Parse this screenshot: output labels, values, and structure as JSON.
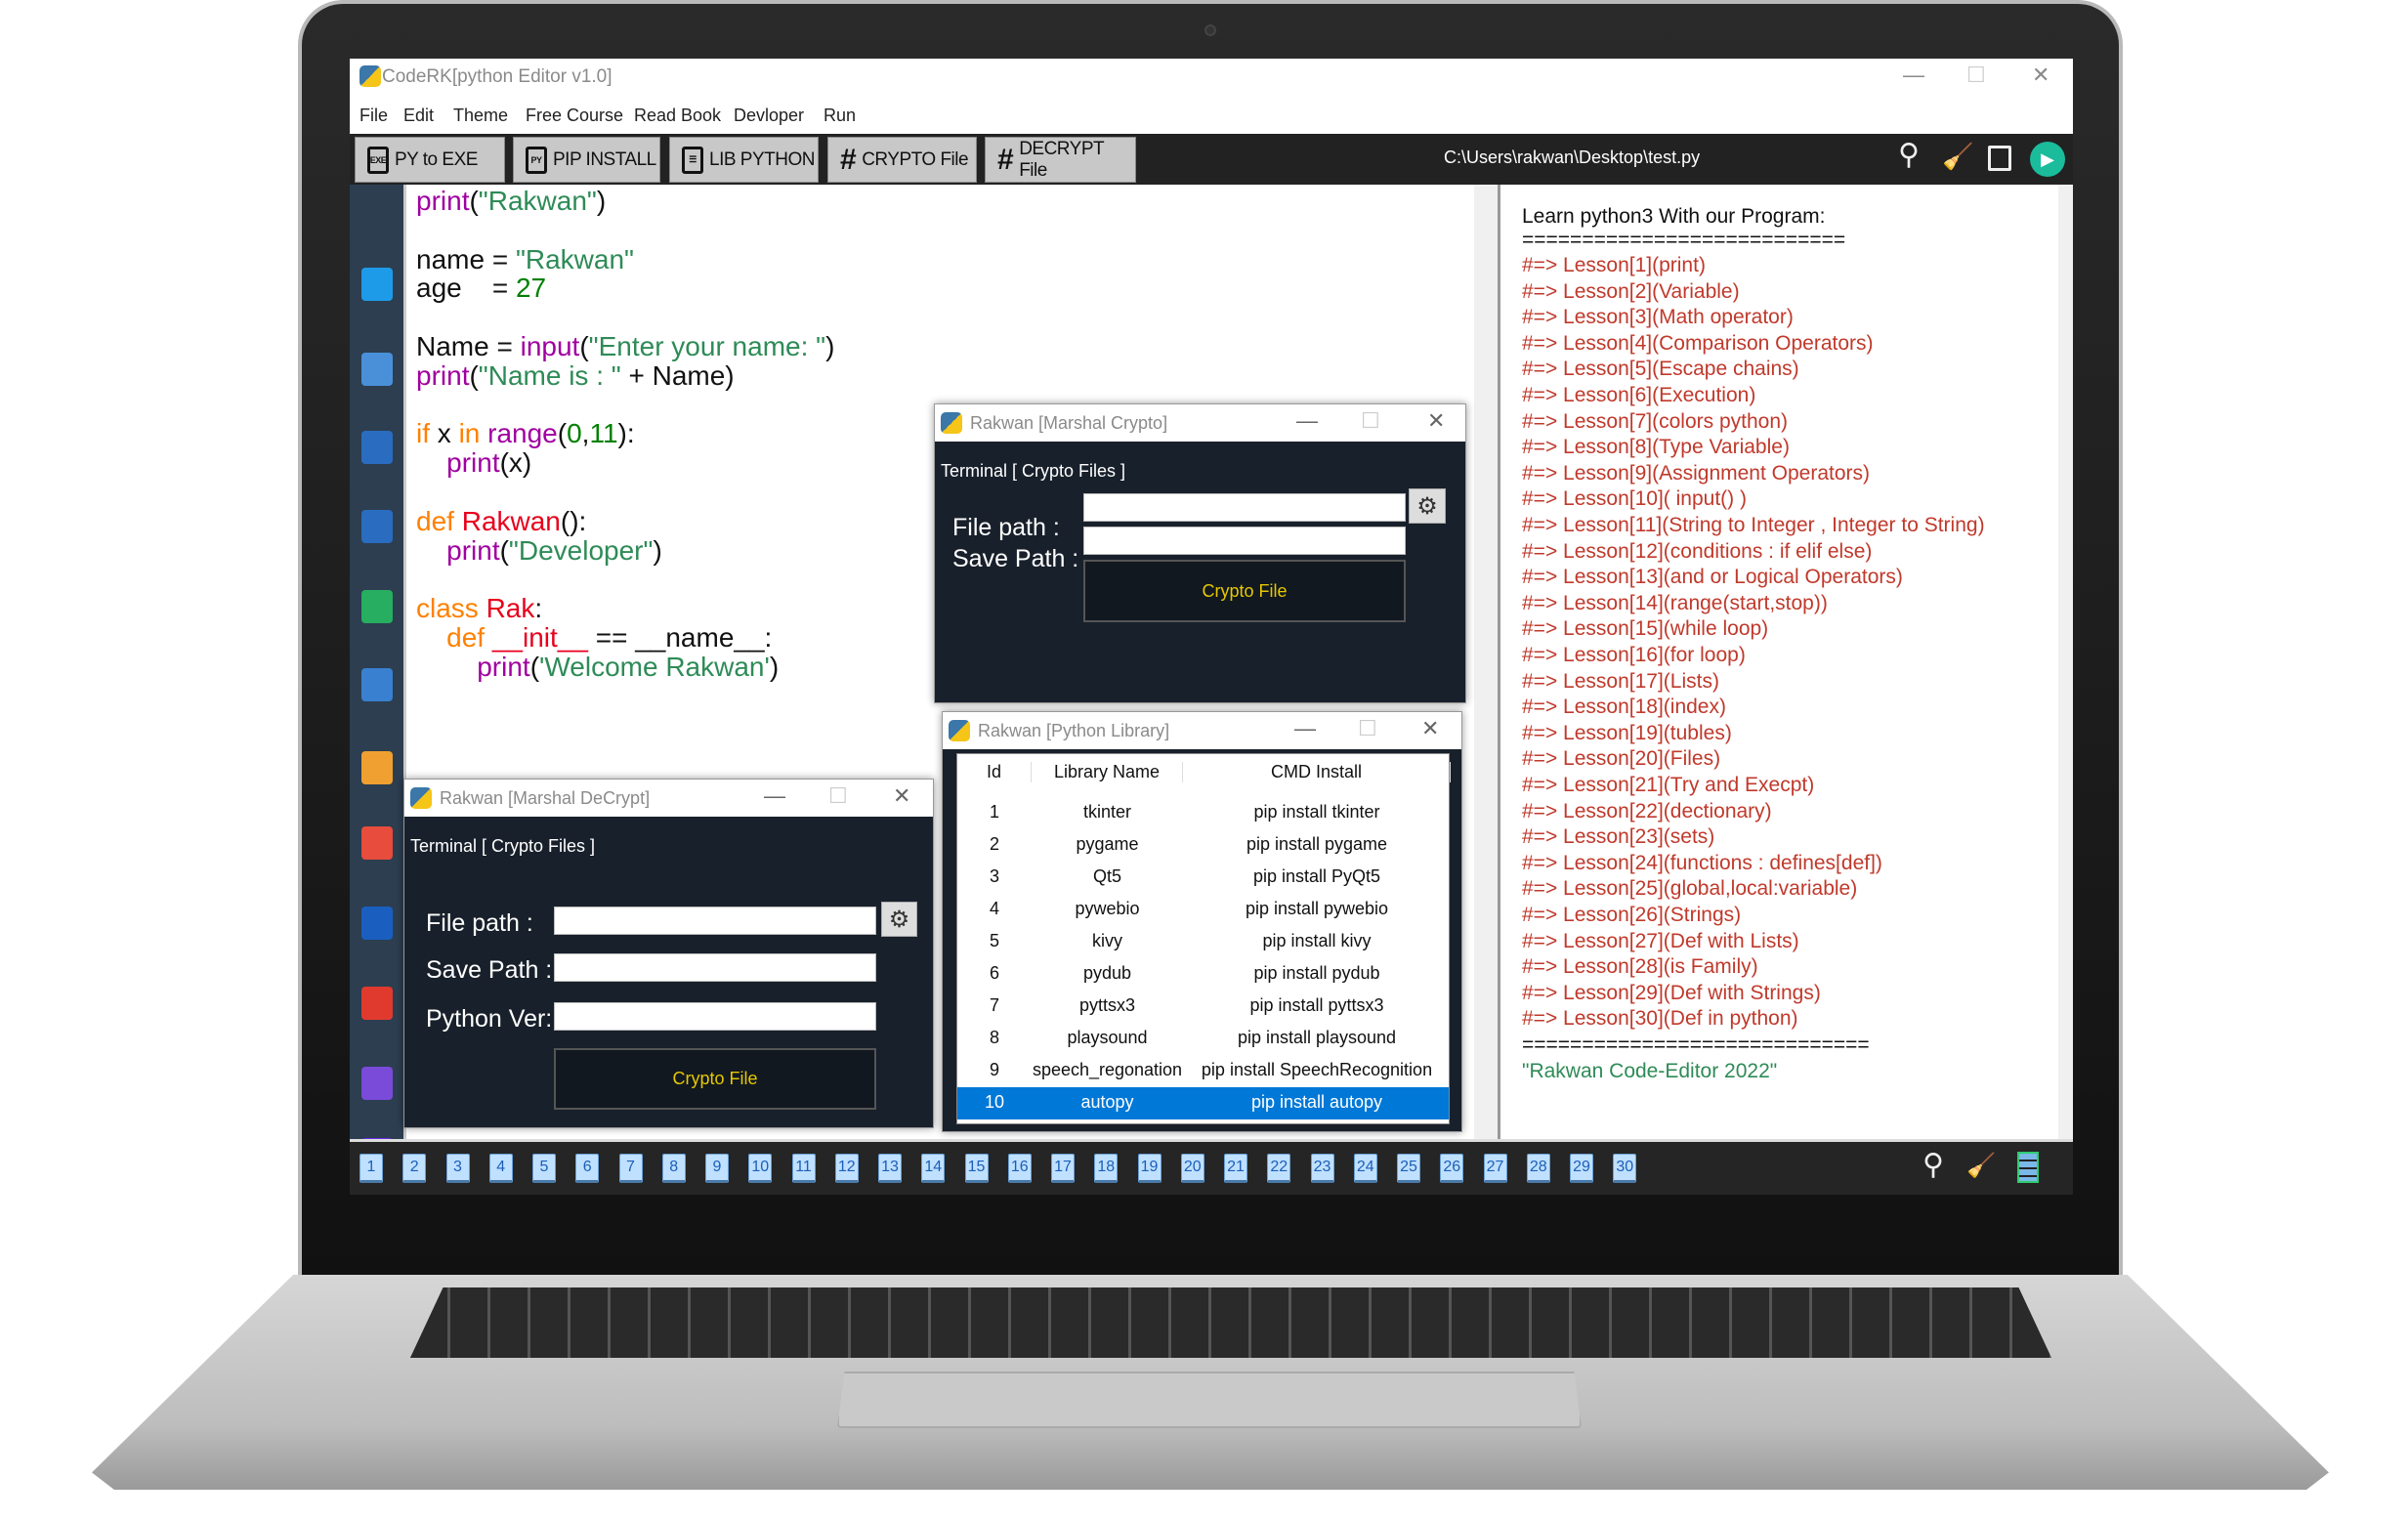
{
  "window": {
    "title": "CodeRK[python Editor v1.0]",
    "minimize": "—",
    "maximize": "☐",
    "close": "✕"
  },
  "menu": [
    "File",
    "Edit",
    "Theme",
    "Free Course",
    "Read Book",
    "Devloper",
    "Run"
  ],
  "toolbar": {
    "buttons": [
      {
        "label": "PY to EXE",
        "icon": "EXE"
      },
      {
        "label": "PIP INSTALL",
        "icon": "PY"
      },
      {
        "label": "LIB PYTHON",
        "icon": "☰"
      },
      {
        "label": "CRYPTO File",
        "icon": "#"
      },
      {
        "label": "DECRYPT File",
        "icon": "#"
      }
    ],
    "path": "C:\\Users\\rakwan\\Desktop\\test.py",
    "icons": [
      "search-icon",
      "broom-icon",
      "save-icon",
      "run-icon"
    ]
  },
  "sidebar": {
    "icons": [
      "new-file-icon",
      "open-folder-icon",
      "download-icon",
      "download-icon-2",
      "table-icon",
      "close-list-icon",
      "user-icon",
      "exit-icon",
      "paypal-icon",
      "youtube-icon",
      "browser-icon",
      "code-icon"
    ]
  },
  "colors": {
    "purple": "#a000a0",
    "string": "#2e8b57",
    "number": "#008000",
    "keyword": "#ff8000",
    "name": "#e8001c",
    "plain": "#111111",
    "lesson": "#c0392b",
    "accent": "#0078d7"
  },
  "editor": {
    "lines": [
      [
        [
          "print",
          "purple"
        ],
        [
          "(",
          "plain"
        ],
        [
          "\"Rakwan\"",
          "string"
        ],
        [
          ")",
          "plain"
        ]
      ],
      [],
      [
        [
          "name = ",
          "plain"
        ],
        [
          "\"Rakwan\"",
          "string"
        ]
      ],
      [
        [
          "age    = ",
          "plain"
        ],
        [
          "27",
          "number"
        ]
      ],
      [],
      [
        [
          "Name = ",
          "plain"
        ],
        [
          "input",
          "purple"
        ],
        [
          "(",
          "plain"
        ],
        [
          "\"Enter your name: \"",
          "string"
        ],
        [
          ")",
          "plain"
        ]
      ],
      [
        [
          "print",
          "purple"
        ],
        [
          "(",
          "plain"
        ],
        [
          "\"Name is : \"",
          "string"
        ],
        [
          " + Name)",
          "plain"
        ]
      ],
      [],
      [
        [
          "if",
          "keyword"
        ],
        [
          " x ",
          "plain"
        ],
        [
          "in",
          "keyword"
        ],
        [
          " ",
          "plain"
        ],
        [
          "range",
          "purple"
        ],
        [
          "(",
          "plain"
        ],
        [
          "0",
          "number"
        ],
        [
          ",",
          "plain"
        ],
        [
          "11",
          "number"
        ],
        [
          "):",
          "plain"
        ]
      ],
      [
        [
          "    ",
          "plain"
        ],
        [
          "print",
          "purple"
        ],
        [
          "(x)",
          "plain"
        ]
      ],
      [],
      [
        [
          "def",
          "keyword"
        ],
        [
          " ",
          "plain"
        ],
        [
          "Rakwan",
          "name"
        ],
        [
          "():",
          "plain"
        ]
      ],
      [
        [
          "    ",
          "plain"
        ],
        [
          "print",
          "purple"
        ],
        [
          "(",
          "plain"
        ],
        [
          "\"Developer\"",
          "string"
        ],
        [
          ")",
          "plain"
        ]
      ],
      [],
      [
        [
          "class",
          "keyword"
        ],
        [
          " ",
          "plain"
        ],
        [
          "Rak",
          "name"
        ],
        [
          ":",
          "plain"
        ]
      ],
      [
        [
          "    ",
          "plain"
        ],
        [
          "def",
          "keyword"
        ],
        [
          " ",
          "plain"
        ],
        [
          "__init__",
          "name"
        ],
        [
          " == __name__:",
          "plain"
        ]
      ],
      [
        [
          "        ",
          "plain"
        ],
        [
          "print",
          "purple"
        ],
        [
          "(",
          "plain"
        ],
        [
          "'Welcome Rakwan'",
          "string"
        ],
        [
          ")",
          "plain"
        ]
      ]
    ]
  },
  "lessons": {
    "header": "Learn python3 With our Program:",
    "sep1": "===========================",
    "items": [
      "#=> Lesson[1](print)",
      "#=> Lesson[2](Variable)",
      "#=> Lesson[3](Math operator)",
      "#=> Lesson[4](Comparison Operators)",
      "#=> Lesson[5](Escape chains)",
      "#=> Lesson[6](Execution)",
      "#=> Lesson[7](colors python)",
      "#=> Lesson[8](Type Variable)",
      "#=> Lesson[9](Assignment Operators)",
      "#=> Lesson[10]( input() )",
      "#=> Lesson[11](String to Integer , Integer to String)",
      "#=> Lesson[12](conditions : if elif else)",
      "#=> Lesson[13](and or Logical Operators)",
      "#=> Lesson[14](range(start,stop))",
      "#=> Lesson[15](while loop)",
      "#=> Lesson[16](for loop)",
      "#=> Lesson[17](Lists)",
      "#=> Lesson[18](index)",
      "#=> Lesson[19](tubles)",
      "#=> Lesson[20](Files)",
      "#=> Lesson[21](Try and Execpt)",
      "#=> Lesson[22](dectionary)",
      "#=> Lesson[23](sets)",
      "#=> Lesson[24](functions : defines[def])",
      "#=> Lesson[25](global,local:variable)",
      "#=> Lesson[26](Strings)",
      "#=> Lesson[27](Def with Lists)",
      "#=> Lesson[28](is Family)",
      "#=> Lesson[29](Def with Strings)",
      "#=> Lesson[30](Def in python)"
    ],
    "sep2": "=============================",
    "footer": "\"Rakwan Code-Editor 2022\""
  },
  "tabs": [
    "1",
    "2",
    "3",
    "4",
    "5",
    "6",
    "7",
    "8",
    "9",
    "10",
    "11",
    "12",
    "13",
    "14",
    "15",
    "16",
    "17",
    "18",
    "19",
    "20",
    "21",
    "22",
    "23",
    "24",
    "25",
    "26",
    "27",
    "28",
    "29",
    "30"
  ],
  "crypto_dialog": {
    "title": "Rakwan [Marshal Crypto]",
    "terminal": "Terminal [ Crypto Files ]",
    "file_path": "File path :",
    "save_path": "Save Path :",
    "button": "Crypto File",
    "file_value": "",
    "save_value": ""
  },
  "decrypt_dialog": {
    "title": "Rakwan [Marshal DeCrypt]",
    "terminal": "Terminal [ Crypto Files ]",
    "file_path": "File path :",
    "save_path": "Save Path :",
    "python_ver": "Python Ver:",
    "button": "Crypto File"
  },
  "library_dialog": {
    "title": "Rakwan [Python Library]",
    "columns": [
      "Id",
      "Library Name",
      "CMD Install"
    ],
    "selected": "10",
    "rows": [
      [
        "1",
        "tkinter",
        "pip install tkinter"
      ],
      [
        "2",
        "pygame",
        "pip install pygame"
      ],
      [
        "3",
        "Qt5",
        "pip install PyQt5"
      ],
      [
        "4",
        "pywebio",
        "pip install pywebio"
      ],
      [
        "5",
        "kivy",
        "pip install kivy"
      ],
      [
        "6",
        "pydub",
        "pip install pydub"
      ],
      [
        "7",
        "pyttsx3",
        "pip install pyttsx3"
      ],
      [
        "8",
        "playsound",
        "pip install playsound"
      ],
      [
        "9",
        "speech_regonation",
        "pip install SpeechRecognition"
      ],
      [
        "10",
        "autopy",
        "pip install autopy"
      ]
    ]
  }
}
